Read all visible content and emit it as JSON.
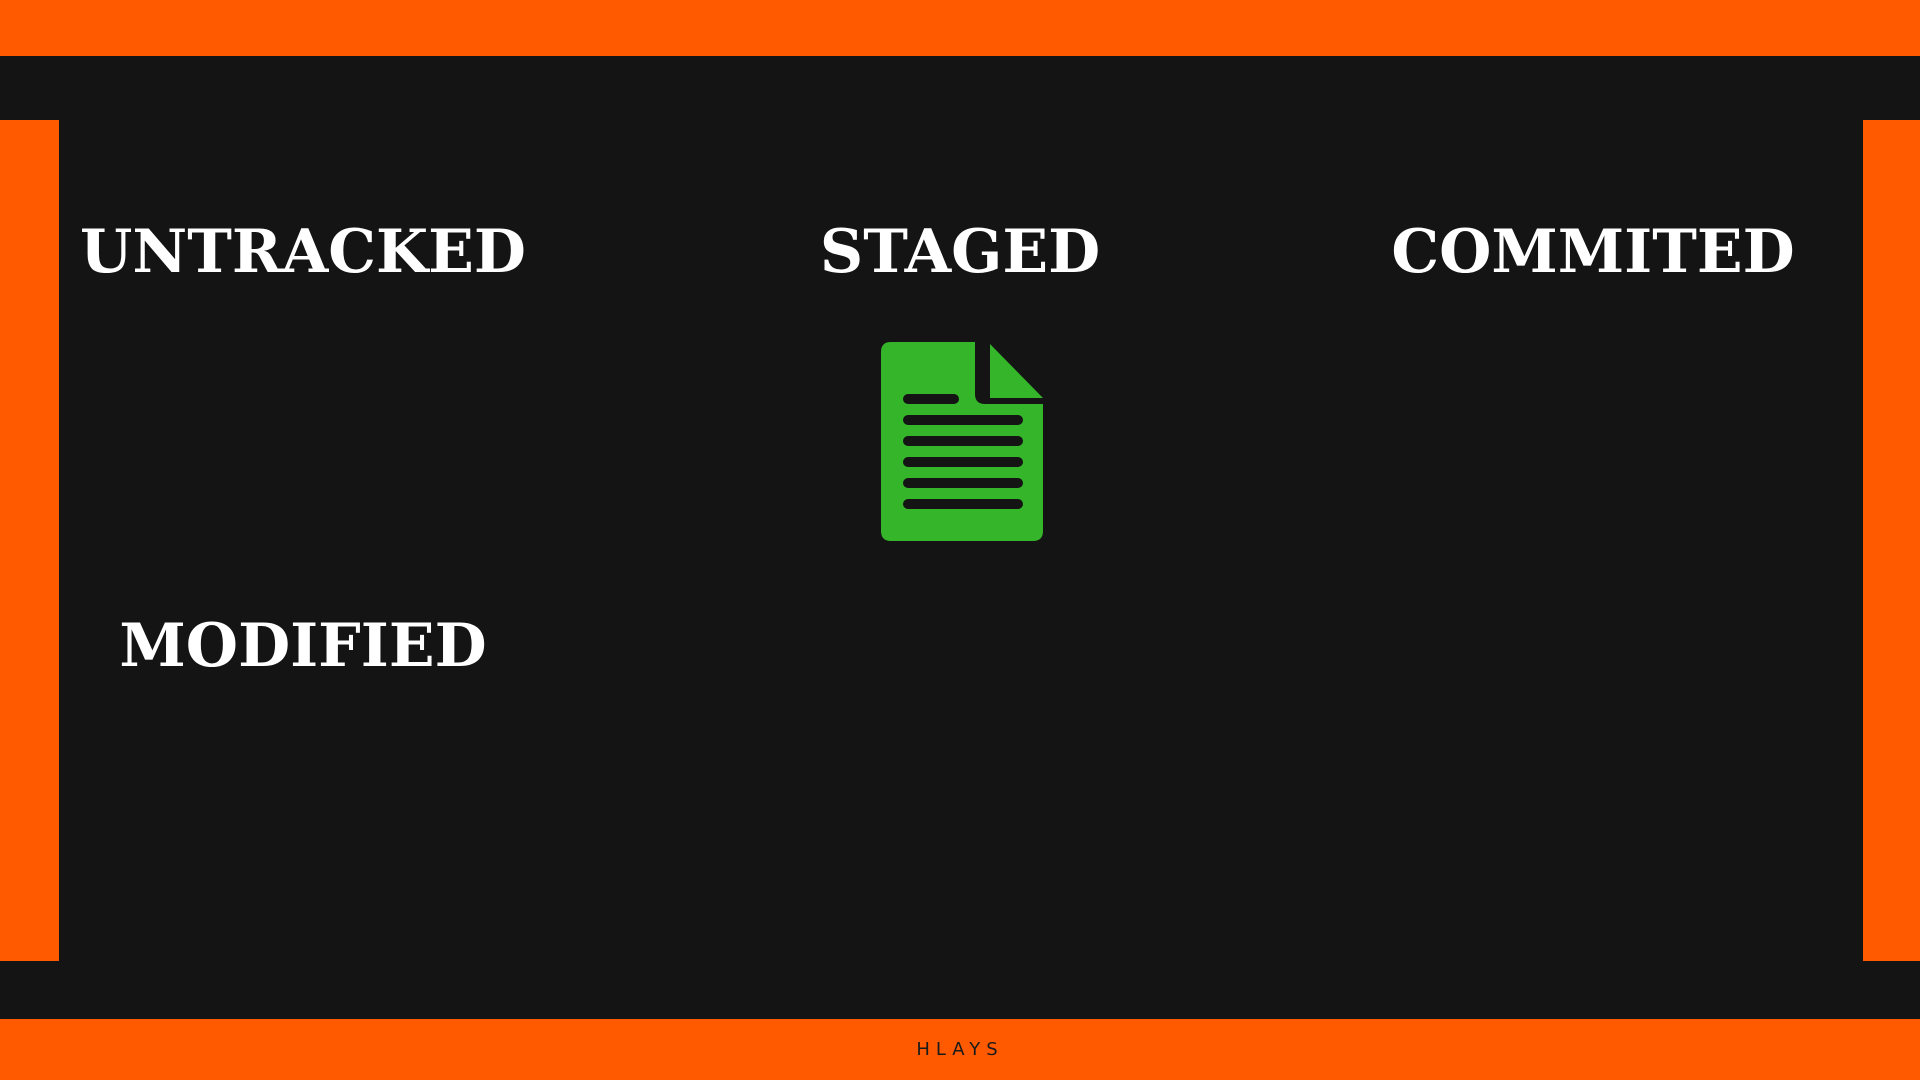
{
  "slide": {
    "states": {
      "untracked": "UNTRACKED",
      "staged": "STAGED",
      "commited": "COMMITED",
      "modified": "MODIFIED"
    },
    "file_icon": "document-icon",
    "brand": "HLAYS"
  },
  "colors": {
    "accent": "#ff5a00",
    "background": "#141414",
    "text": "#ffffff",
    "file": "#35b52a"
  }
}
